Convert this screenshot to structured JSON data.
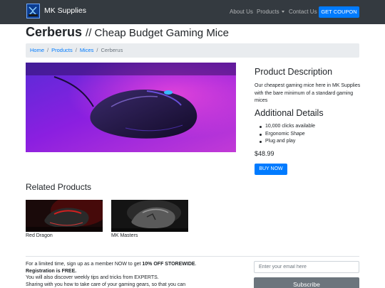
{
  "navbar": {
    "brand": "MK Supplies",
    "links": [
      {
        "label": "About Us"
      },
      {
        "label": "Products"
      },
      {
        "label": "Contact Us"
      }
    ],
    "coupon_label": "GET COUPON",
    "bg_color": "#343a40"
  },
  "product": {
    "name": "Cerberus",
    "subtitle": "// Cheap Budget Gaming Mice",
    "price": "$48.99",
    "buy_label": "BUY NOW"
  },
  "breadcrumb": {
    "items": [
      "Home",
      "Products",
      "Mices"
    ],
    "active": "Cerberus",
    "separator": "/"
  },
  "description": {
    "heading": "Product Description",
    "text": "Our cheapest gaming mice here in MK Supplies with the bare minimum of a standard gaming mices"
  },
  "details": {
    "heading": "Additional Details",
    "items": [
      "10,000 clicks available",
      "Ergonomic Shape",
      "Plug and play"
    ]
  },
  "related": {
    "heading": "Related Products",
    "products": [
      {
        "label": "Red Dragon"
      },
      {
        "label": "MK Masters"
      }
    ]
  },
  "newsletter": {
    "line1_prefix": "For a limited time, sign up as a member NOW to get ",
    "line1_bold": "10% OFF STOREWIDE",
    "line1_suffix": ".",
    "line2": "Registration is FREE.",
    "line3": "You will also discover weekly tips and tricks from EXPERTS.",
    "line4": "Sharing with you how to take care of your gaming gears, so that you can",
    "email_placeholder": "Enter your email here",
    "subscribe_label": "Subscribe"
  },
  "colors": {
    "accent": "#007bff",
    "secondary": "#6c757d",
    "breadcrumb_bg": "#e9ecef"
  }
}
